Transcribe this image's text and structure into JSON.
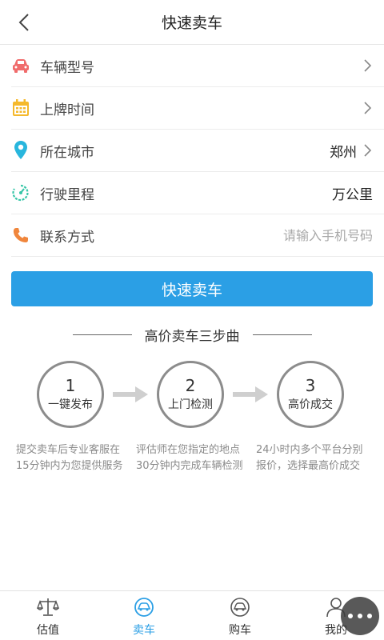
{
  "header": {
    "title": "快速卖车",
    "back_icon": "chevron-left-icon"
  },
  "form": {
    "rows": [
      {
        "label": "车辆型号",
        "value": "",
        "icon": "car-icon",
        "icon_color": "#f06c6c",
        "has_chevron": true
      },
      {
        "label": "上牌时间",
        "value": "",
        "icon": "calendar-icon",
        "icon_color": "#f5b92c",
        "has_chevron": true
      },
      {
        "label": "所在城市",
        "value": "郑州",
        "icon": "location-pin-icon",
        "icon_color": "#28b6dd",
        "has_chevron": true
      },
      {
        "label": "行驶里程",
        "value": "万公里",
        "icon": "speedometer-icon",
        "icon_color": "#38c6a8",
        "has_chevron": false
      },
      {
        "label": "联系方式",
        "placeholder": "请输入手机号码",
        "icon": "phone-icon",
        "icon_color": "#f0863c",
        "has_chevron": false
      }
    ]
  },
  "submit": {
    "label": "快速卖车",
    "color": "#2b9fe5"
  },
  "steps_section": {
    "title": "高价卖车三步曲",
    "steps": [
      {
        "number": "1",
        "name": "一键发布",
        "desc": "提交卖车后专业客服在15分钟内为您提供服务"
      },
      {
        "number": "2",
        "name": "上门检测",
        "desc": "评估师在您指定的地点30分钟内完成车辆检测"
      },
      {
        "number": "3",
        "name": "高价成交",
        "desc": "24小时内多个平台分别报价，选择最高价成交"
      }
    ]
  },
  "tabbar": {
    "items": [
      {
        "label": "估值",
        "icon": "scale-icon",
        "active": false
      },
      {
        "label": "卖车",
        "icon": "sell-car-icon",
        "active": true
      },
      {
        "label": "购车",
        "icon": "buy-car-icon",
        "active": false
      },
      {
        "label": "我的",
        "icon": "user-icon",
        "active": false
      }
    ],
    "active_color": "#2b9fe5"
  },
  "floating_button": {
    "icon": "more-dots-icon"
  }
}
